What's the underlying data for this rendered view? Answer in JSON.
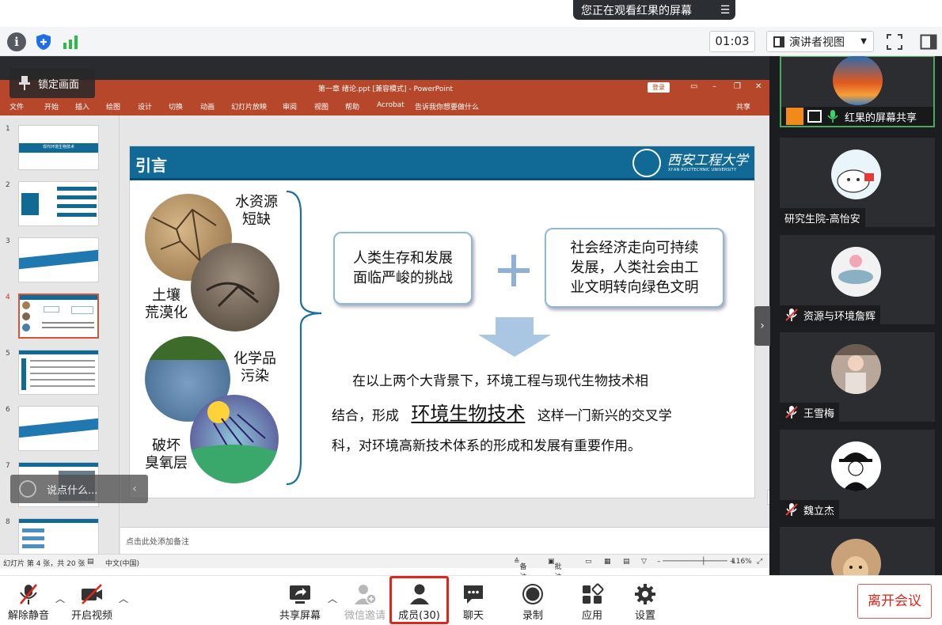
{
  "banner": {
    "text": "您正在观看红果的屏幕"
  },
  "toolbar": {
    "timer": "01:03",
    "view_mode": "演讲者视图"
  },
  "overlay": {
    "lock_label": "锁定画面",
    "chat_placeholder": "说点什么..."
  },
  "ppt": {
    "title": "第一章 绪论.ppt [兼容模式] - PowerPoint",
    "login": "登录",
    "menu": [
      "文件",
      "开始",
      "插入",
      "绘图",
      "设计",
      "切换",
      "动画",
      "幻灯片放映",
      "审阅",
      "视图",
      "帮助",
      "Acrobat",
      "告诉我你想要做什么"
    ],
    "share": "共享",
    "thumb_numbers": [
      "1",
      "2",
      "3",
      "4",
      "5",
      "6",
      "7",
      "8"
    ],
    "thumb1_title": "现代环境生物技术",
    "notes_placeholder": "点击此处添加备注",
    "status": {
      "slide_info": "幻灯片 第 4 张，共 20 张",
      "language": "中文(中国)",
      "notes_btn": "备注",
      "comments_btn": "批注",
      "zoom": "116%"
    },
    "ime_label": "中"
  },
  "slide": {
    "heading": "引言",
    "university": "西安工程大学",
    "university_en": "XI'AN POLYTECHNIC UNIVERSITY",
    "captions": {
      "water": [
        "水资源",
        "短缺"
      ],
      "soil": [
        "土壤",
        "荒漠化"
      ],
      "chem": [
        "化学品",
        "污染"
      ],
      "ozone": [
        "破坏",
        "臭氧层"
      ]
    },
    "box1": [
      "人类生存和发展",
      "面临严峻的挑战"
    ],
    "box2": [
      "社会经济走向可持续",
      "发展，人类社会由工",
      "业文明转向绿色文明"
    ],
    "para_line1": "在以上两个大背景下，环境工程与现代生物技术相",
    "para_line2a": "结合，形成",
    "para_line2b": "环境生物技术",
    "para_line2c": "这样一门新兴的交叉学",
    "para_line3": "科，对环境高新技术体系的形成和发展有重要作用。"
  },
  "participants": [
    {
      "name": "红果的屏幕共享",
      "muted": false
    },
    {
      "name": "研究生院-高怡安",
      "muted": false
    },
    {
      "name": "资源与环境詹辉",
      "muted": true
    },
    {
      "name": "王雪梅",
      "muted": true
    },
    {
      "name": "魏立杰",
      "muted": true
    }
  ],
  "bottom": {
    "unmute": "解除静音",
    "video": "开启视频",
    "share_screen": "共享屏幕",
    "wechat_invite": "微信邀请",
    "members": "成员(30)",
    "chat": "聊天",
    "record": "录制",
    "apps": "应用",
    "settings": "设置",
    "leave": "离开会议"
  },
  "colors": {
    "ppt_accent": "#b7472a",
    "slide_blue": "#106a95",
    "leave_red": "#e0251b",
    "active_green": "#4ba95e"
  }
}
